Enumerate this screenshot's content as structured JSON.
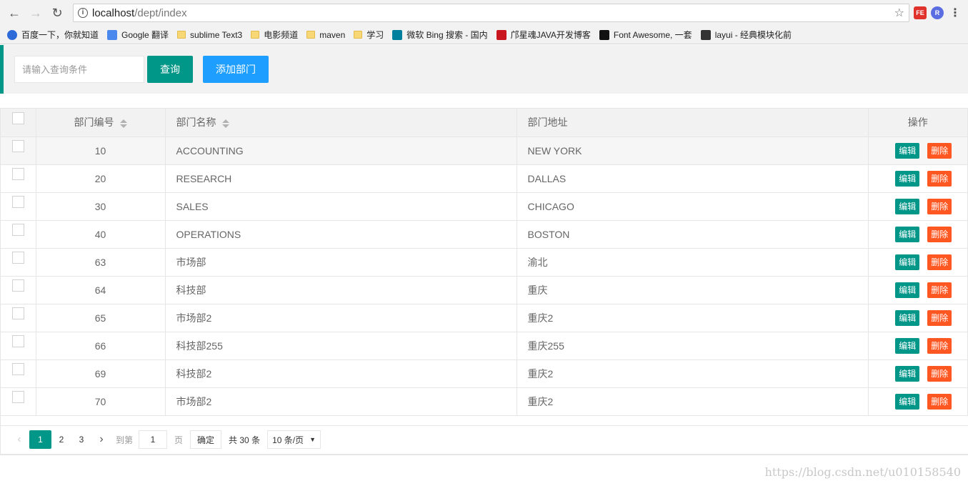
{
  "browser": {
    "url_host": "localhost",
    "url_path": "/dept/index",
    "info_glyph": "i",
    "ext_fe_label": "FE",
    "ext_r_label": "R",
    "bookmarks": [
      {
        "label": "百度一下，你就知道",
        "icon": "baidu-icon"
      },
      {
        "label": "Google 翻译",
        "icon": "google-translate-icon"
      },
      {
        "label": "sublime Text3",
        "icon": "folder-icon"
      },
      {
        "label": "电影频道",
        "icon": "folder-icon"
      },
      {
        "label": "maven",
        "icon": "folder-icon"
      },
      {
        "label": "学习",
        "icon": "folder-icon"
      },
      {
        "label": "微软 Bing 搜索 - 国内",
        "icon": "bing-icon"
      },
      {
        "label": "邝星魂JAVA开发博客",
        "icon": "csdn-icon"
      },
      {
        "label": "Font Awesome, 一套",
        "icon": "font-awesome-icon"
      },
      {
        "label": "layui - 经典模块化前",
        "icon": "layui-icon"
      }
    ]
  },
  "search": {
    "placeholder": "请输入查询条件",
    "query_label": "查询",
    "add_label": "添加部门"
  },
  "table": {
    "headers": {
      "id": "部门编号",
      "name": "部门名称",
      "loc": "部门地址",
      "op": "操作"
    },
    "edit_label": "编辑",
    "delete_label": "删除",
    "rows": [
      {
        "id": "10",
        "name": "ACCOUNTING",
        "loc": "NEW YORK"
      },
      {
        "id": "20",
        "name": "RESEARCH",
        "loc": "DALLAS"
      },
      {
        "id": "30",
        "name": "SALES",
        "loc": "CHICAGO"
      },
      {
        "id": "40",
        "name": "OPERATIONS",
        "loc": "BOSTON"
      },
      {
        "id": "63",
        "name": "市场部",
        "loc": "渝北"
      },
      {
        "id": "64",
        "name": "科技部",
        "loc": "重庆"
      },
      {
        "id": "65",
        "name": "市场部2",
        "loc": "重庆2"
      },
      {
        "id": "66",
        "name": "科技部255",
        "loc": "重庆255"
      },
      {
        "id": "69",
        "name": "科技部2",
        "loc": "重庆2"
      },
      {
        "id": "70",
        "name": "市场部2",
        "loc": "重庆2"
      }
    ]
  },
  "pager": {
    "pages": [
      "1",
      "2",
      "3"
    ],
    "current": "1",
    "goto_label": "到第",
    "goto_value": "1",
    "page_unit": "页",
    "confirm_label": "确定",
    "total_text": "共 30 条",
    "page_size": "10 条/页"
  },
  "watermark": "https://blog.csdn.net/u010158540"
}
